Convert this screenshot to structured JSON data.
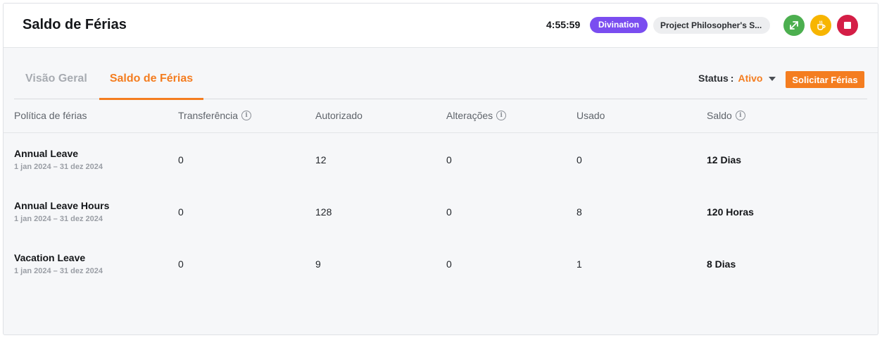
{
  "header": {
    "title": "Saldo de Férias",
    "timer": "4:55:59",
    "activity_badge": "Divination",
    "project_badge": "Project Philosopher's S...",
    "buttons": [
      {
        "icon": "resume-tracking-icon",
        "color": "#4caf4f"
      },
      {
        "icon": "coffee-break-icon",
        "color": "#f7b500"
      },
      {
        "icon": "stop-icon",
        "color": "#d41e46"
      }
    ]
  },
  "tabs": [
    {
      "label": "Visão Geral",
      "active": false
    },
    {
      "label": "Saldo de Férias",
      "active": true
    }
  ],
  "filters": {
    "status_label": "Status",
    "status_separator": ":",
    "status_value": "Ativo"
  },
  "actions": {
    "request_label": "Solicitar Férias"
  },
  "accent_color": "#f47d20",
  "table": {
    "columns": [
      {
        "label": "Política de férias",
        "info": false
      },
      {
        "label": "Transferência",
        "info": true
      },
      {
        "label": "Autorizado",
        "info": false
      },
      {
        "label": "Alterações",
        "info": true
      },
      {
        "label": "Usado",
        "info": false
      },
      {
        "label": "Saldo",
        "info": true
      }
    ],
    "rows": [
      {
        "policy": "Annual Leave",
        "period": "1 jan 2024 – 31 dez 2024",
        "transfer": "0",
        "authorized": "12",
        "changes": "0",
        "used": "0",
        "balance": "12 Dias"
      },
      {
        "policy": "Annual Leave Hours",
        "period": "1 jan 2024 – 31 dez 2024",
        "transfer": "0",
        "authorized": "128",
        "changes": "0",
        "used": "8",
        "balance": "120 Horas"
      },
      {
        "policy": "Vacation Leave",
        "period": "1 jan 2024 – 31 dez 2024",
        "transfer": "0",
        "authorized": "9",
        "changes": "0",
        "used": "1",
        "balance": "8 Dias"
      }
    ]
  }
}
